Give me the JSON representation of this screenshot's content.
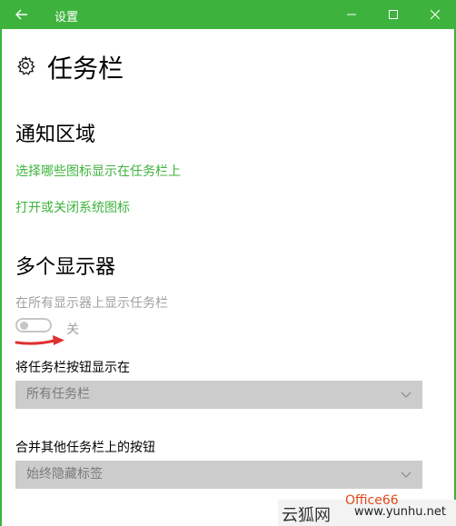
{
  "window": {
    "title": "设置",
    "accent_color": "#3db33d"
  },
  "page": {
    "title": "任务栏",
    "icon": "gear-icon"
  },
  "notification_area": {
    "heading": "通知区域",
    "links": [
      "选择哪些图标显示在任务栏上",
      "打开或关闭系统图标"
    ]
  },
  "multiple_displays": {
    "heading": "多个显示器",
    "show_taskbar_label": "在所有显示器上显示任务栏",
    "toggle_state": "关",
    "toggle_on": false,
    "show_buttons_label": "将任务栏按钮显示在",
    "show_buttons_value": "所有任务栏",
    "combine_label": "合并其他任务栏上的按钮",
    "combine_value": "始终隐藏标签"
  },
  "annotation": {
    "arrow_color": "#e03030"
  },
  "watermark": {
    "cn": "云狐网",
    "url": "www.yunhu.net",
    "red_text": "Office66"
  }
}
